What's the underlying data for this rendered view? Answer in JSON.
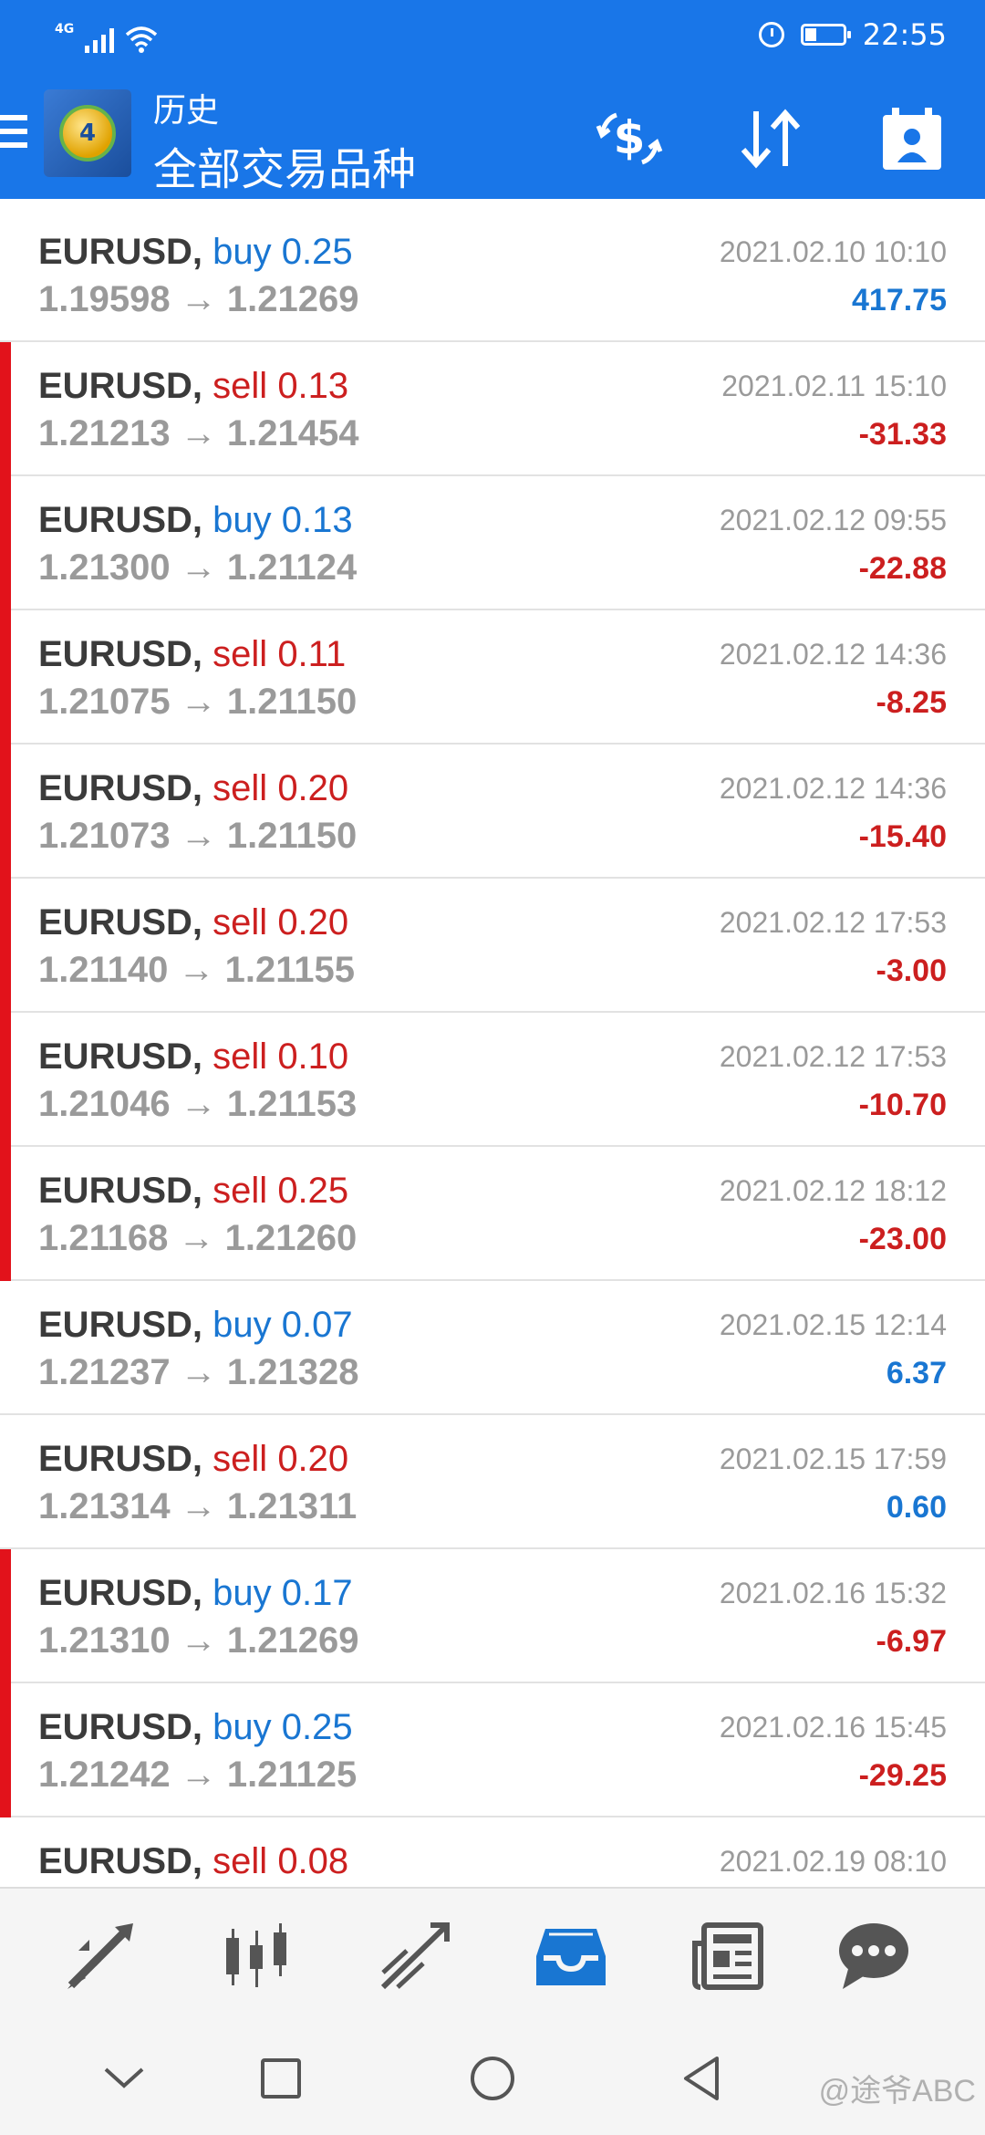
{
  "status_bar": {
    "network": "4G",
    "time": "22:55"
  },
  "header": {
    "title_top": "历史",
    "title_main": "全部交易品种",
    "logo_text": "4"
  },
  "colors": {
    "accent": "#1976e8",
    "buy": "#1976d2",
    "sell": "#cc1f1f",
    "loss_marker": "#e2121b"
  },
  "trades": [
    {
      "symbol": "EURUSD,",
      "direction": "buy",
      "volume": "0.25",
      "open": "1.19598",
      "close": "1.21269",
      "time": "2021.02.10 10:10",
      "profit": "417.75",
      "loss": false
    },
    {
      "symbol": "EURUSD,",
      "direction": "sell",
      "volume": "0.13",
      "open": "1.21213",
      "close": "1.21454",
      "time": "2021.02.11 15:10",
      "profit": "-31.33",
      "loss": true
    },
    {
      "symbol": "EURUSD,",
      "direction": "buy",
      "volume": "0.13",
      "open": "1.21300",
      "close": "1.21124",
      "time": "2021.02.12 09:55",
      "profit": "-22.88",
      "loss": true
    },
    {
      "symbol": "EURUSD,",
      "direction": "sell",
      "volume": "0.11",
      "open": "1.21075",
      "close": "1.21150",
      "time": "2021.02.12 14:36",
      "profit": "-8.25",
      "loss": true
    },
    {
      "symbol": "EURUSD,",
      "direction": "sell",
      "volume": "0.20",
      "open": "1.21073",
      "close": "1.21150",
      "time": "2021.02.12 14:36",
      "profit": "-15.40",
      "loss": true
    },
    {
      "symbol": "EURUSD,",
      "direction": "sell",
      "volume": "0.20",
      "open": "1.21140",
      "close": "1.21155",
      "time": "2021.02.12 17:53",
      "profit": "-3.00",
      "loss": true
    },
    {
      "symbol": "EURUSD,",
      "direction": "sell",
      "volume": "0.10",
      "open": "1.21046",
      "close": "1.21153",
      "time": "2021.02.12 17:53",
      "profit": "-10.70",
      "loss": true
    },
    {
      "symbol": "EURUSD,",
      "direction": "sell",
      "volume": "0.25",
      "open": "1.21168",
      "close": "1.21260",
      "time": "2021.02.12 18:12",
      "profit": "-23.00",
      "loss": true
    },
    {
      "symbol": "EURUSD,",
      "direction": "buy",
      "volume": "0.07",
      "open": "1.21237",
      "close": "1.21328",
      "time": "2021.02.15 12:14",
      "profit": "6.37",
      "loss": false
    },
    {
      "symbol": "EURUSD,",
      "direction": "sell",
      "volume": "0.20",
      "open": "1.21314",
      "close": "1.21311",
      "time": "2021.02.15 17:59",
      "profit": "0.60",
      "loss": false
    },
    {
      "symbol": "EURUSD,",
      "direction": "buy",
      "volume": "0.17",
      "open": "1.21310",
      "close": "1.21269",
      "time": "2021.02.16 15:32",
      "profit": "-6.97",
      "loss": true
    },
    {
      "symbol": "EURUSD,",
      "direction": "buy",
      "volume": "0.25",
      "open": "1.21242",
      "close": "1.21125",
      "time": "2021.02.16 15:45",
      "profit": "-29.25",
      "loss": true
    },
    {
      "symbol": "EURUSD,",
      "direction": "sell",
      "volume": "0.08",
      "open": "",
      "close": "",
      "time": "2021.02.19 08:10",
      "profit": "",
      "loss": false
    }
  ],
  "arrow": "→",
  "tabs": [
    {
      "name": "quotes",
      "icon": "quotes-arrows-icon",
      "active": false
    },
    {
      "name": "chart",
      "icon": "candlestick-icon",
      "active": false
    },
    {
      "name": "trade",
      "icon": "trend-lines-icon",
      "active": false
    },
    {
      "name": "history",
      "icon": "inbox-tray-icon",
      "active": true
    },
    {
      "name": "news",
      "icon": "newspaper-icon",
      "active": false
    },
    {
      "name": "messages",
      "icon": "chat-bubble-icon",
      "active": false
    }
  ],
  "watermark": "@途爷ABC"
}
